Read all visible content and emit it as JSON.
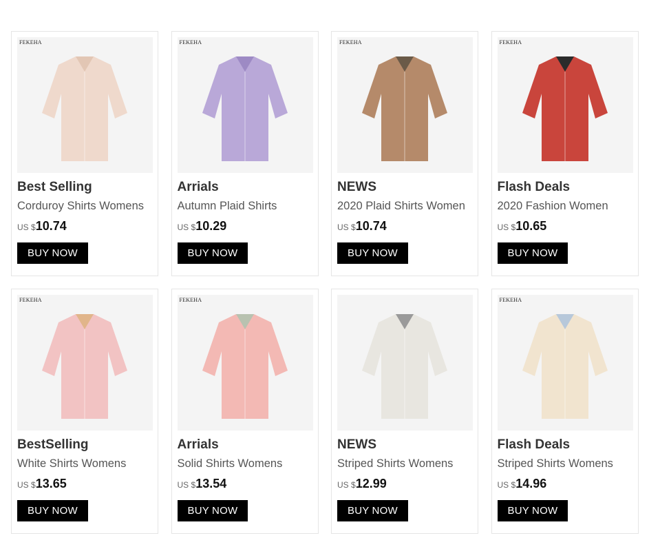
{
  "products": [
    {
      "brand": "FEKEHA",
      "tag": "Best Selling",
      "subtitle": "Corduroy Shirts Womens",
      "currency": "US $",
      "price": "10.74",
      "button": "BUY NOW",
      "colors": [
        "#efd9cc",
        "#e2c6b4"
      ]
    },
    {
      "brand": "FEKEHA",
      "tag": "Arrials",
      "subtitle": "Autumn Plaid Shirts",
      "currency": "US $",
      "price": "10.29",
      "button": "BUY NOW",
      "colors": [
        "#b9a8d8",
        "#9d8ac4"
      ]
    },
    {
      "brand": "FEKEHA",
      "tag": "NEWS",
      "subtitle": "2020 Plaid Shirts Women",
      "currency": "US $",
      "price": "10.74",
      "button": "BUY NOW",
      "colors": [
        "#b58a6a",
        "#6a5a48"
      ]
    },
    {
      "brand": "FEKEHA",
      "tag": "Flash Deals",
      "subtitle": "2020 Fashion Women",
      "currency": "US $",
      "price": "10.65",
      "button": "BUY NOW",
      "colors": [
        "#c9453c",
        "#2b2b2b"
      ]
    },
    {
      "brand": "FEKEHA",
      "tag": "BestSelling",
      "subtitle": "White Shirts Womens",
      "currency": "US $",
      "price": "13.65",
      "button": "BUY NOW",
      "colors": [
        "#f2c3c3",
        "#e1b58a"
      ]
    },
    {
      "brand": "FEKEHA",
      "tag": "Arrials",
      "subtitle": "Solid Shirts Womens",
      "currency": "US $",
      "price": "13.54",
      "button": "BUY NOW",
      "colors": [
        "#f3b9b4",
        "#b8c2b0"
      ]
    },
    {
      "brand": "",
      "tag": "NEWS",
      "subtitle": "Striped Shirts Womens",
      "currency": "US $",
      "price": "12.99",
      "button": "BUY NOW",
      "colors": [
        "#e8e6e0",
        "#9a9a9a"
      ]
    },
    {
      "brand": "FEKEHA",
      "tag": "Flash Deals",
      "subtitle": "Striped Shirts Womens",
      "currency": "US $",
      "price": "14.96",
      "button": "BUY NOW",
      "colors": [
        "#f1e4cf",
        "#b7c8da"
      ]
    }
  ]
}
